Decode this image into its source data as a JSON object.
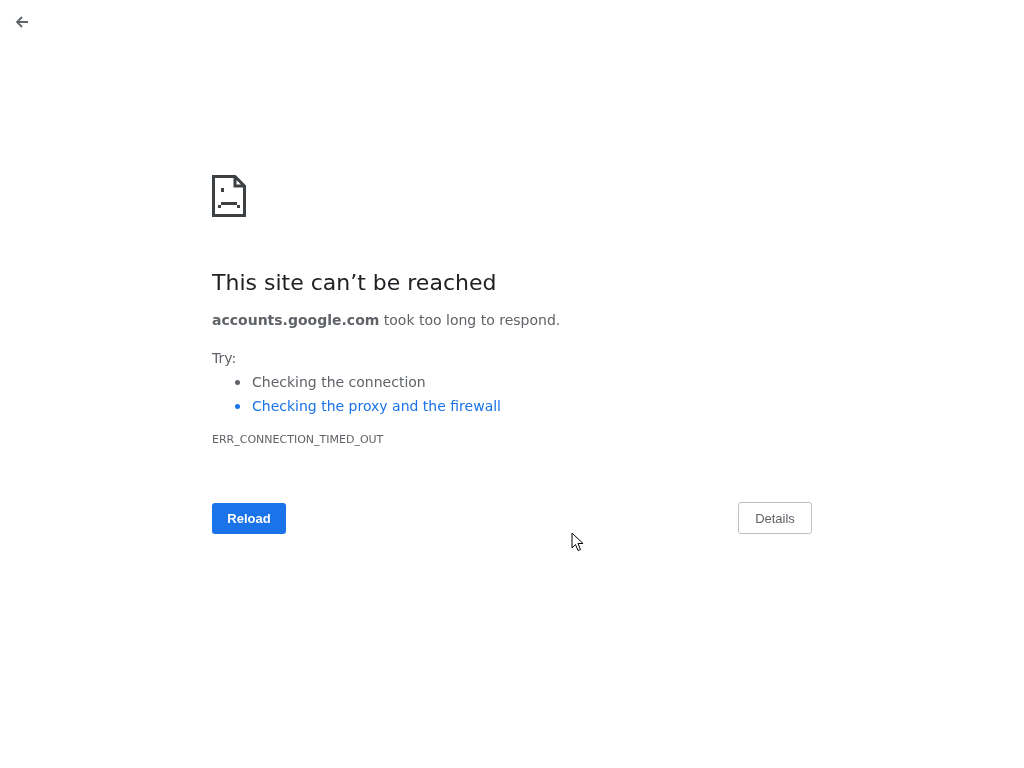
{
  "heading": "This site can’t be reached",
  "summary": "**accounts.google.com** took too long to respond.",
  "suggestions_label": "Try:",
  "suggestions": [
    {
      "text": "Checking the connection",
      "kind": "text"
    },
    {
      "text": "Checking the proxy and the firewall",
      "kind": "link"
    }
  ],
  "error_code": "ERR_CONNECTION_TIMED_OUT",
  "buttons": {
    "reload": "Reload",
    "details": "Details"
  }
}
